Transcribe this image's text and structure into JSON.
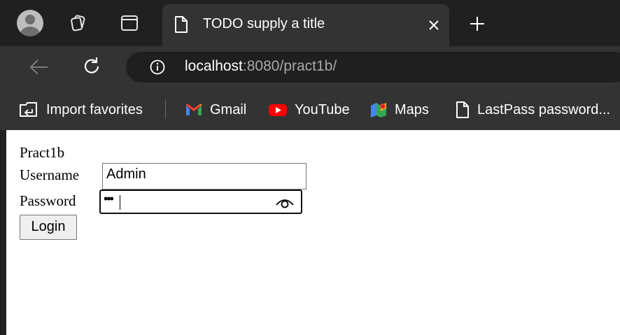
{
  "browser": {
    "tab": {
      "title": "TODO supply a title"
    },
    "address": {
      "host": "localhost",
      "rest": ":8080/pract1b/"
    },
    "bookmarks": [
      {
        "label": "Import favorites",
        "icon": "import-icon"
      },
      {
        "label": "Gmail",
        "icon": "gmail-icon"
      },
      {
        "label": "YouTube",
        "icon": "youtube-icon"
      },
      {
        "label": "Maps",
        "icon": "maps-icon"
      },
      {
        "label": "LastPass password...",
        "icon": "document-icon"
      }
    ]
  },
  "page": {
    "heading": "Pract1b",
    "username_label": "Username",
    "username_value": "Admin",
    "password_label": "Password",
    "password_masked": "•••",
    "login_label": "Login"
  },
  "colors": {
    "tabstrip_bg": "#202020",
    "toolbar_bg": "#333333",
    "omnibox_bg": "#1f1f1f",
    "youtube_red": "#ff0000",
    "page_bg": "#ffffff"
  }
}
